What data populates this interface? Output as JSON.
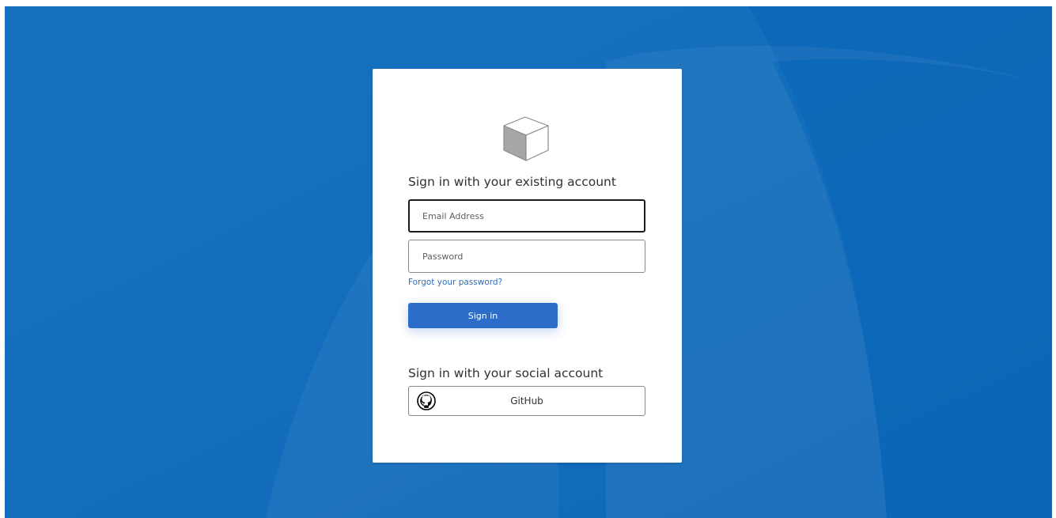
{
  "theme": {
    "background": "#1470bf",
    "accent": "#2b6dc8",
    "link": "#2c6fbd"
  },
  "logo": {
    "icon": "cube-icon"
  },
  "local_account": {
    "heading": "Sign in with your existing account",
    "email": {
      "placeholder": "Email Address",
      "value": ""
    },
    "password": {
      "placeholder": "Password",
      "value": ""
    },
    "forgot_password": "Forgot your password?",
    "signin_button": "Sign in"
  },
  "social_account": {
    "heading": "Sign in with your social account",
    "providers": [
      {
        "label": "GitHub",
        "icon": "github-icon"
      }
    ]
  }
}
